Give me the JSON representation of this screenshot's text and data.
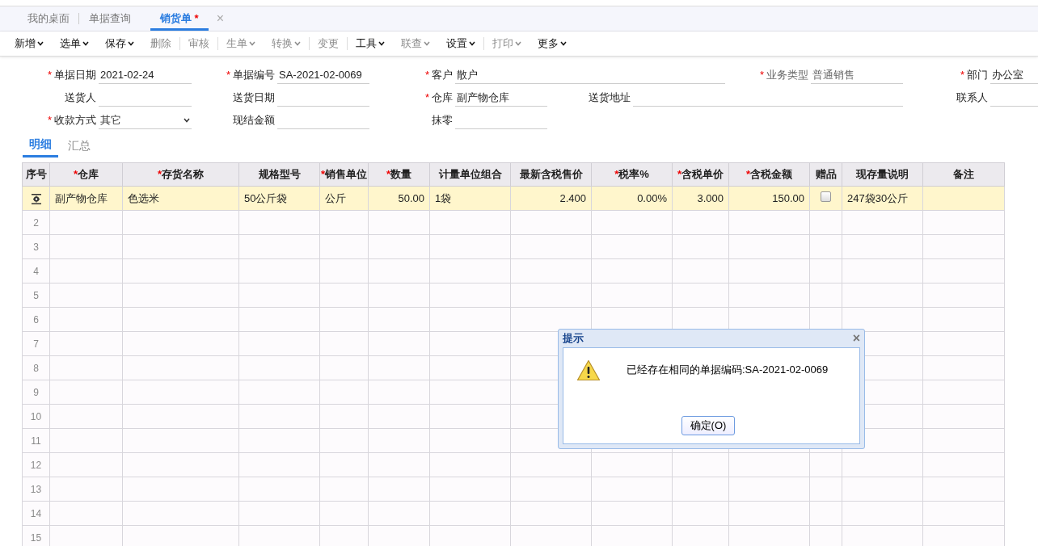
{
  "tabs": [
    {
      "label": "我的桌面",
      "selected": false
    },
    {
      "label": "单据查询",
      "selected": false
    },
    {
      "label": "销货单",
      "marker": "*",
      "close": "×",
      "selected": true
    }
  ],
  "toolbar": [
    {
      "label": "新增",
      "dropdown": true,
      "disabled": false,
      "divider_after": false
    },
    {
      "label": "选单",
      "dropdown": true,
      "disabled": false,
      "divider_after": false
    },
    {
      "label": "保存",
      "dropdown": true,
      "disabled": false,
      "divider_after": false
    },
    {
      "label": "删除",
      "dropdown": false,
      "disabled": true,
      "divider_after": true
    },
    {
      "label": "审核",
      "dropdown": false,
      "disabled": true,
      "divider_after": true
    },
    {
      "label": "生单",
      "dropdown": true,
      "disabled": true,
      "divider_after": false
    },
    {
      "label": "转换",
      "dropdown": true,
      "disabled": true,
      "divider_after": true
    },
    {
      "label": "变更",
      "dropdown": false,
      "disabled": true,
      "divider_after": true
    },
    {
      "label": "工具",
      "dropdown": true,
      "disabled": false,
      "divider_after": false
    },
    {
      "label": "联查",
      "dropdown": true,
      "disabled": true,
      "divider_after": false
    },
    {
      "label": "设置",
      "dropdown": true,
      "disabled": false,
      "divider_after": true
    },
    {
      "label": "打印",
      "dropdown": true,
      "disabled": true,
      "divider_after": false
    },
    {
      "label": "更多",
      "dropdown": true,
      "disabled": false,
      "divider_after": false
    }
  ],
  "form": [
    [
      {
        "label": "单据日期",
        "required": true,
        "kind": "text",
        "value": "2021-02-24"
      },
      {
        "label": "单据编号",
        "required": true,
        "kind": "text",
        "value": "SA-2021-02-0069"
      },
      {
        "label": "客户",
        "required": true,
        "kind": "text",
        "value": "散户"
      },
      {
        "label": "业务类型",
        "required": true,
        "kind": "readonly",
        "value": "普通销售"
      },
      {
        "label": "部门",
        "required": true,
        "kind": "text",
        "value": "办公室"
      }
    ],
    [
      {
        "label": "送货人",
        "required": false,
        "kind": "text"
      },
      {
        "label": "送货日期",
        "required": false,
        "kind": "text"
      },
      {
        "label": "仓库",
        "required": true,
        "kind": "text",
        "value": "副产物仓库"
      },
      {
        "label": "送货地址",
        "required": false,
        "kind": "text"
      },
      {
        "label": "联系人",
        "required": false,
        "kind": "text"
      }
    ],
    [
      {
        "label": "收款方式",
        "required": true,
        "kind": "select",
        "value": "其它"
      },
      {
        "label": "现结金额",
        "required": false,
        "kind": "text"
      },
      {
        "label": "抹零",
        "required": false,
        "kind": "text"
      }
    ]
  ],
  "subtabs": [
    {
      "label": "明细",
      "selected": true
    },
    {
      "label": "汇总",
      "selected": false
    }
  ],
  "table": {
    "columns": [
      {
        "label": "序号",
        "required": false
      },
      {
        "label": "仓库",
        "required": true
      },
      {
        "label": "存货名称",
        "required": true
      },
      {
        "label": "规格型号",
        "required": false
      },
      {
        "label": "销售单位",
        "required": true
      },
      {
        "label": "数量",
        "required": true
      },
      {
        "label": "计量单位组合",
        "required": false
      },
      {
        "label": "最新含税售价",
        "required": false
      },
      {
        "label": "税率%",
        "required": true
      },
      {
        "label": "含税单价",
        "required": true
      },
      {
        "label": "含税金额",
        "required": true
      },
      {
        "label": "赠品",
        "required": false
      },
      {
        "label": "现存量说明",
        "required": false
      },
      {
        "label": "备注",
        "required": false
      }
    ],
    "rows": [
      {
        "selected": true,
        "warehouse": "副产物仓库",
        "item": "色选米",
        "spec": "50公斤袋",
        "unit": "公斤",
        "qty": "50.00",
        "unit_group": "1袋",
        "latest_price": "2.400",
        "tax_rate": "0.00%",
        "unit_price": "3.000",
        "amount": "150.00",
        "gift": false,
        "stock_note": "247袋30公斤"
      },
      {
        "selected": false,
        "number": "2"
      },
      {
        "selected": false,
        "number": "3"
      },
      {
        "selected": false,
        "number": "4"
      },
      {
        "selected": false,
        "number": "5"
      },
      {
        "selected": false,
        "number": "6"
      },
      {
        "selected": false,
        "number": "7"
      },
      {
        "selected": false,
        "number": "8"
      },
      {
        "selected": false,
        "number": "9"
      },
      {
        "selected": false,
        "number": "10"
      },
      {
        "selected": false,
        "number": "11"
      },
      {
        "selected": false,
        "number": "12"
      },
      {
        "selected": false,
        "number": "13"
      },
      {
        "selected": false,
        "number": "14"
      },
      {
        "selected": false,
        "number": "15"
      }
    ]
  },
  "dialog": {
    "title": "提示",
    "close": "×",
    "message": "已经存在相同的单据编码:SA-2021-02-0069",
    "button": "确定(O)"
  }
}
